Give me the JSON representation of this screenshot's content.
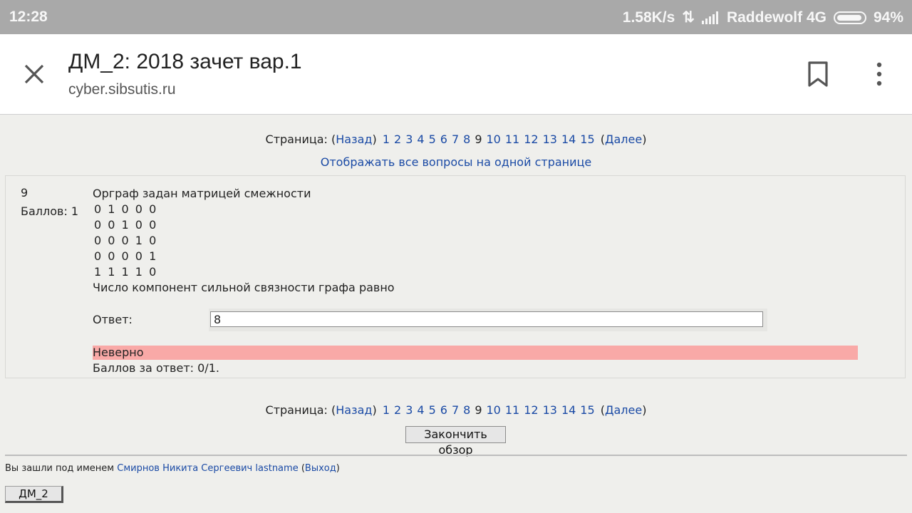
{
  "status": {
    "time": "12:28",
    "speed": "1.58K/s",
    "carrier": "Raddewolf 4G",
    "battery": "94%"
  },
  "tab": {
    "title": "ДМ_2: 2018 зачет вар.1",
    "url": "cyber.sibsutis.ru"
  },
  "pager": {
    "label": "Страница:",
    "prev": "Назад",
    "next": "Далее",
    "pages": [
      "1",
      "2",
      "3",
      "4",
      "5",
      "6",
      "7",
      "8",
      "9",
      "10",
      "11",
      "12",
      "13",
      "14",
      "15"
    ],
    "current": "9"
  },
  "show_all": "Отображать все вопросы на одной странице",
  "question": {
    "number": "9",
    "score": "Баллов: 1",
    "text_line1": "Орграф задан матрицей смежности",
    "matrix": [
      "0 1 0 0 0",
      "0 0 1 0 0",
      "0 0 0 1 0",
      "0 0 0 0 1",
      "1 1 1 1 0"
    ],
    "text_line2": "Число компонент сильной связности графа равно",
    "answer_label": "Ответ:",
    "answer_value": "8",
    "feedback": "Неверно",
    "points": "Баллов за ответ: 0/1."
  },
  "finish_button": "Закончить обзор",
  "login": {
    "prefix": "Вы зашли под именем",
    "user": "Смирнов Никита Сергеевич lastname",
    "logout": "Выход"
  },
  "course_button": "ДМ_2"
}
